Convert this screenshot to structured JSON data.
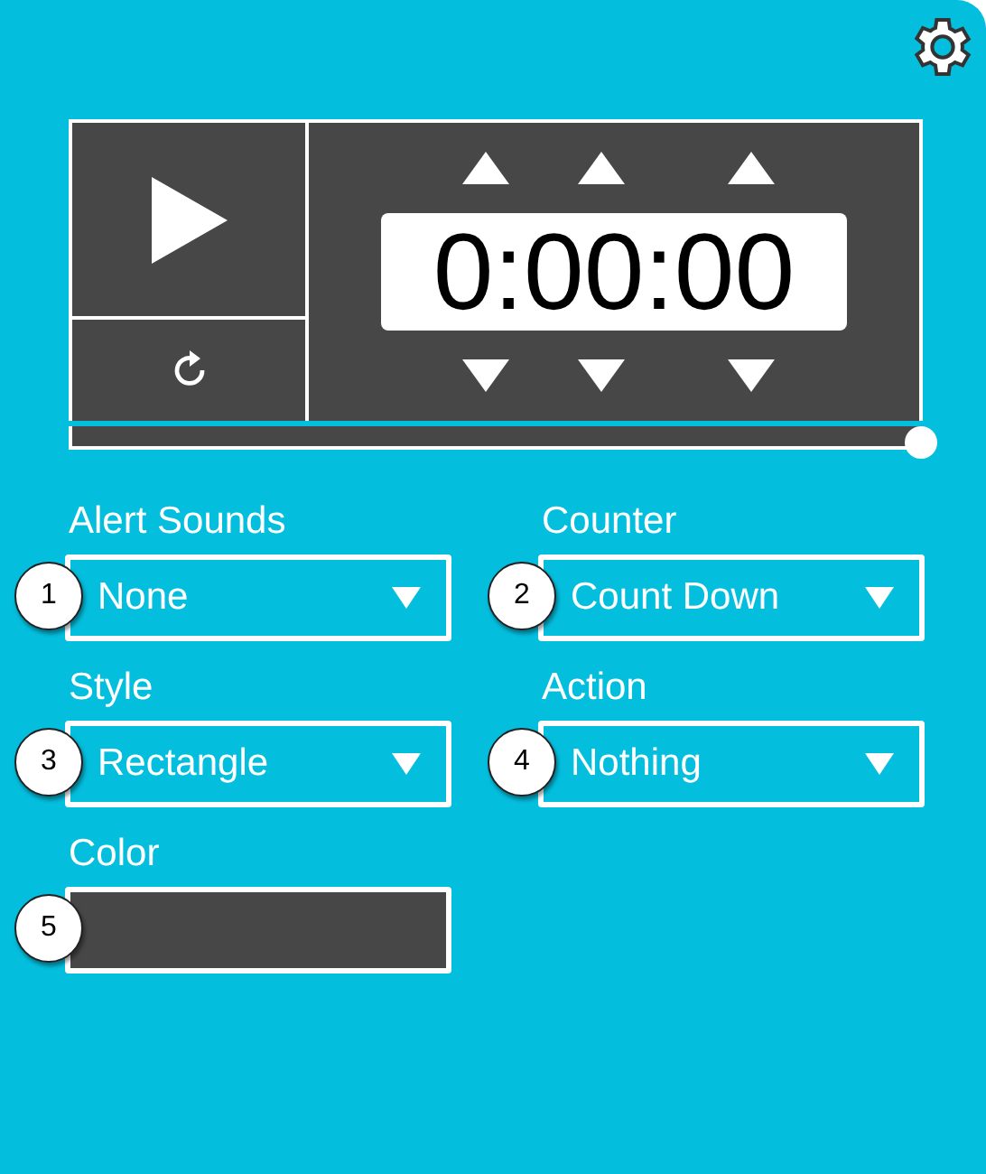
{
  "timer": {
    "display": "0:00:00",
    "progress": {
      "level": 1
    }
  },
  "settings": [
    {
      "kind": "select",
      "label": "Alert Sounds",
      "badge": "1",
      "value": "None"
    },
    {
      "kind": "select",
      "label": "Counter",
      "badge": "2",
      "value": "Count Down"
    },
    {
      "kind": "select",
      "label": "Style",
      "badge": "3",
      "value": "Rectangle"
    },
    {
      "kind": "select",
      "label": "Action",
      "badge": "4",
      "value": "Nothing"
    },
    {
      "kind": "color",
      "label": "Color",
      "badge": "5",
      "color": "#474747"
    }
  ]
}
